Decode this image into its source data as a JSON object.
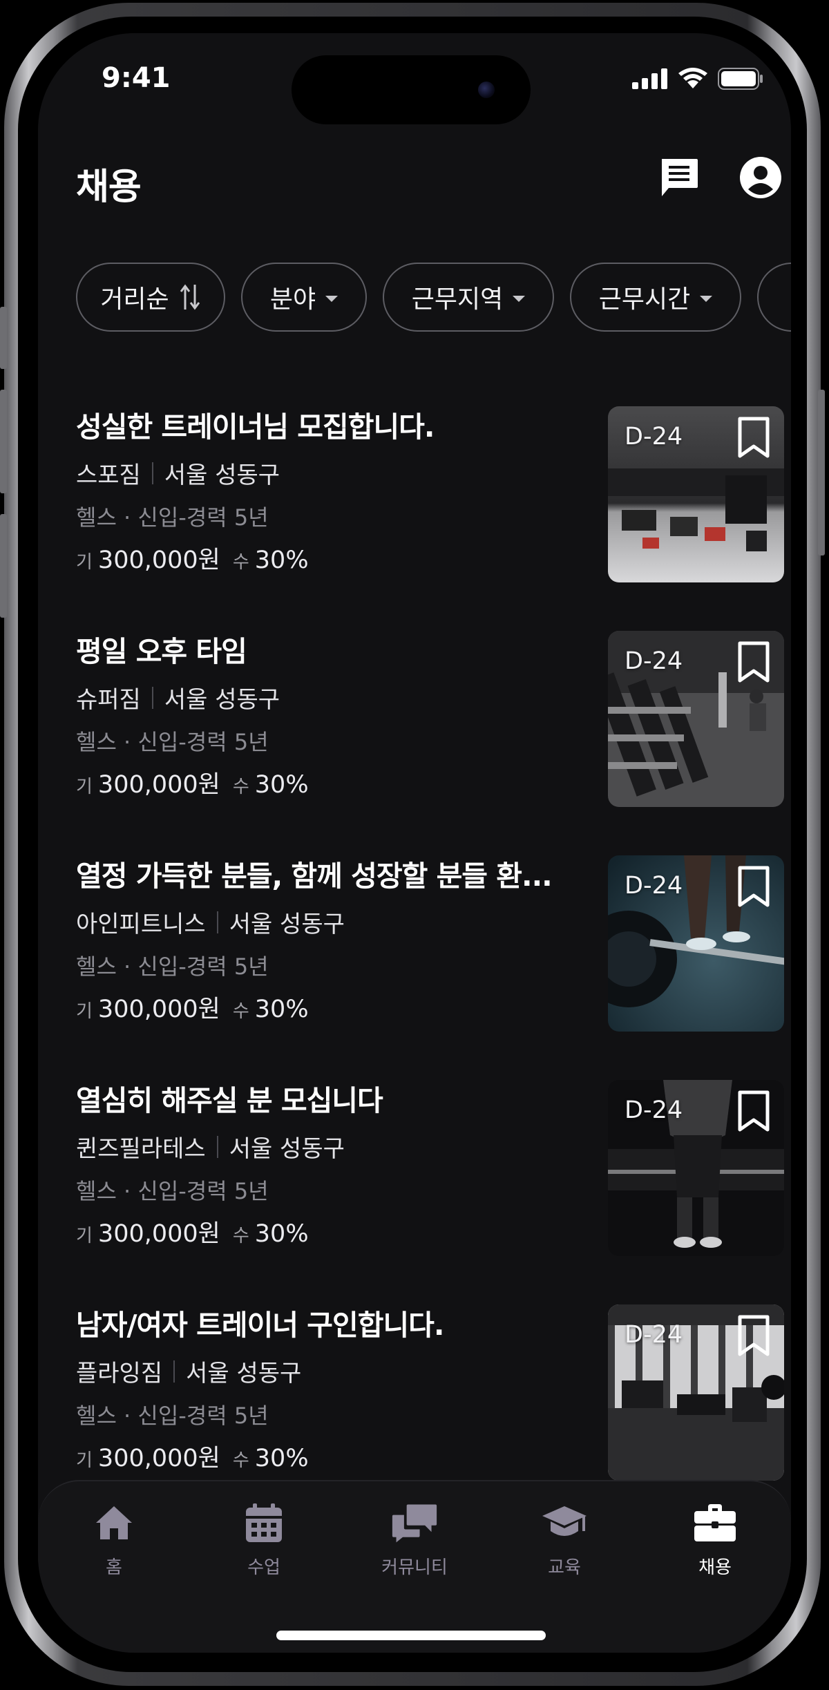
{
  "status": {
    "time": "9:41"
  },
  "header": {
    "title": "채용"
  },
  "filters": [
    {
      "label": "거리순",
      "icon": "sort-icon"
    },
    {
      "label": "분야",
      "icon": "caret-down-icon"
    },
    {
      "label": "근무지역",
      "icon": "caret-down-icon"
    },
    {
      "label": "근무시간",
      "icon": "caret-down-icon"
    }
  ],
  "posts": [
    {
      "title": "성실한 트레이너님 모집합니다.",
      "company": "스포짐",
      "location": "서울 성동구",
      "subtitle": "헬스 · 신입-경력 5년",
      "base_label": "기",
      "base_pay": "300,000원",
      "commission_label": "수",
      "commission": "30%",
      "dday": "D-24"
    },
    {
      "title": "평일 오후 타임",
      "company": "슈퍼짐",
      "location": "서울 성동구",
      "subtitle": "헬스 · 신입-경력 5년",
      "base_label": "기",
      "base_pay": "300,000원",
      "commission_label": "수",
      "commission": "30%",
      "dday": "D-24"
    },
    {
      "title": "열정 가득한 분들, 함께 성장할 분들 환...",
      "company": "아인피트니스",
      "location": "서울 성동구",
      "subtitle": "헬스 · 신입-경력 5년",
      "base_label": "기",
      "base_pay": "300,000원",
      "commission_label": "수",
      "commission": "30%",
      "dday": "D-24"
    },
    {
      "title": "열심히 해주실 분 모십니다",
      "company": "퀸즈필라테스",
      "location": "서울 성동구",
      "subtitle": "헬스 · 신입-경력 5년",
      "base_label": "기",
      "base_pay": "300,000원",
      "commission_label": "수",
      "commission": "30%",
      "dday": "D-24"
    },
    {
      "title": "남자/여자 트레이너 구인합니다.",
      "company": "플라잉짐",
      "location": "서울 성동구",
      "subtitle": "헬스 · 신입-경력 5년",
      "base_label": "기",
      "base_pay": "300,000원",
      "commission_label": "수",
      "commission": "30%",
      "dday": "D-24"
    }
  ],
  "tabs": [
    {
      "label": "홈",
      "icon": "home-icon"
    },
    {
      "label": "수업",
      "icon": "calendar-icon"
    },
    {
      "label": "커뮤니티",
      "icon": "chat-bubbles-icon"
    },
    {
      "label": "교육",
      "icon": "graduation-cap-icon"
    },
    {
      "label": "채용",
      "icon": "briefcase-icon",
      "active": true
    }
  ],
  "colors": {
    "background": "#111113",
    "inactive_tab": "#8f8a9c",
    "chip_border": "#5d5d63"
  }
}
